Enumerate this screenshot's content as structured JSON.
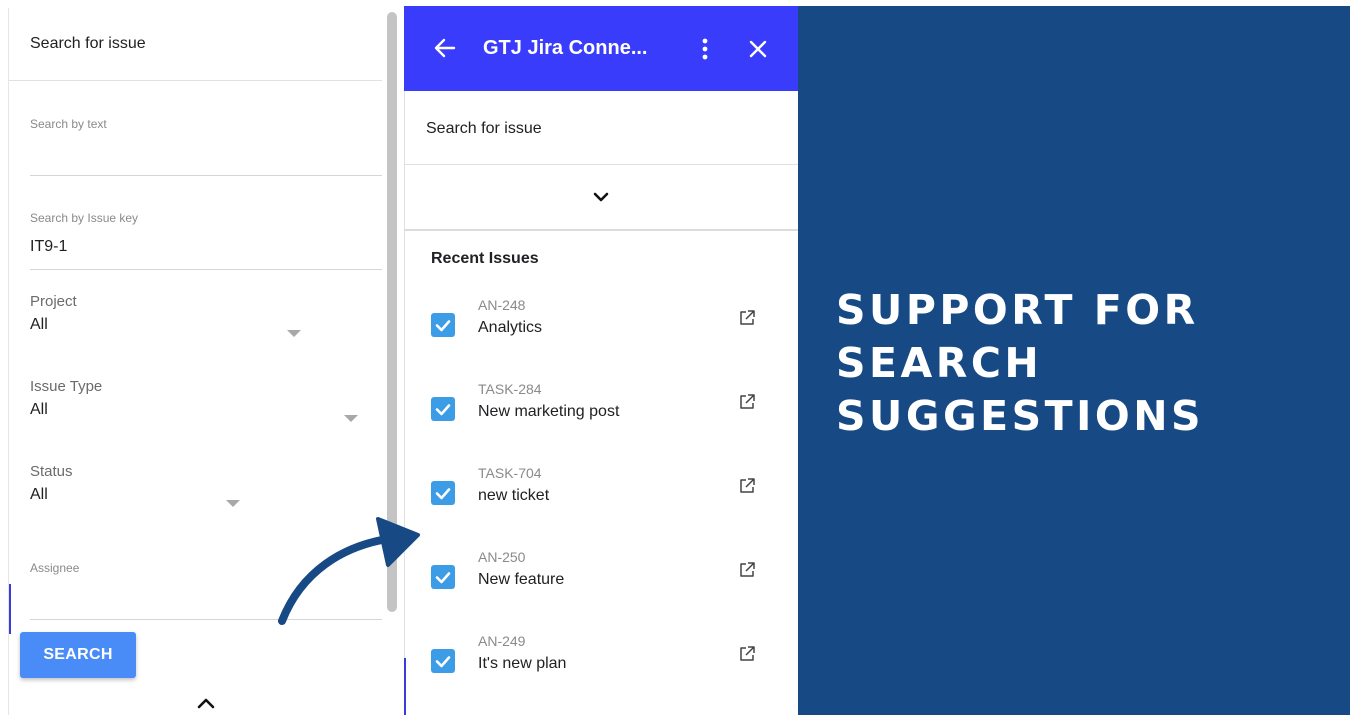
{
  "left_panel": {
    "header": "Search for issue",
    "search_text": {
      "label": "Search by text",
      "value": ""
    },
    "search_key": {
      "label": "Search by Issue key",
      "value": "IT9-1"
    },
    "project": {
      "label": "Project",
      "value": "All"
    },
    "issue_type": {
      "label": "Issue Type",
      "value": "All"
    },
    "status": {
      "label": "Status",
      "value": "All"
    },
    "assignee": {
      "label": "Assignee",
      "value": ""
    },
    "search_button": "SEARCH"
  },
  "middle_panel": {
    "topbar": {
      "title": "GTJ Jira Conne...",
      "color": "#3a3cfb"
    },
    "search_header": "Search for issue",
    "recent_title": "Recent Issues",
    "issues": [
      {
        "key": "AN-248",
        "summary": "Analytics",
        "checked": true
      },
      {
        "key": "TASK-284",
        "summary": "New marketing post",
        "checked": true
      },
      {
        "key": "TASK-704",
        "summary": "new ticket",
        "checked": true
      },
      {
        "key": "AN-250",
        "summary": "New feature",
        "checked": true
      },
      {
        "key": "AN-249",
        "summary": "It's new plan",
        "checked": true
      }
    ]
  },
  "right_panel": {
    "headline": [
      "SUPPORT FOR",
      "SEARCH",
      "SUGGESTIONS"
    ],
    "background": "#174a85"
  },
  "icons": [
    "back-arrow-icon",
    "kebab-menu-icon",
    "close-icon",
    "chevron-down-icon",
    "chevron-up-icon",
    "checkbox-checked-icon",
    "external-link-icon",
    "dropdown-caret-icon",
    "curved-arrow-icon"
  ]
}
